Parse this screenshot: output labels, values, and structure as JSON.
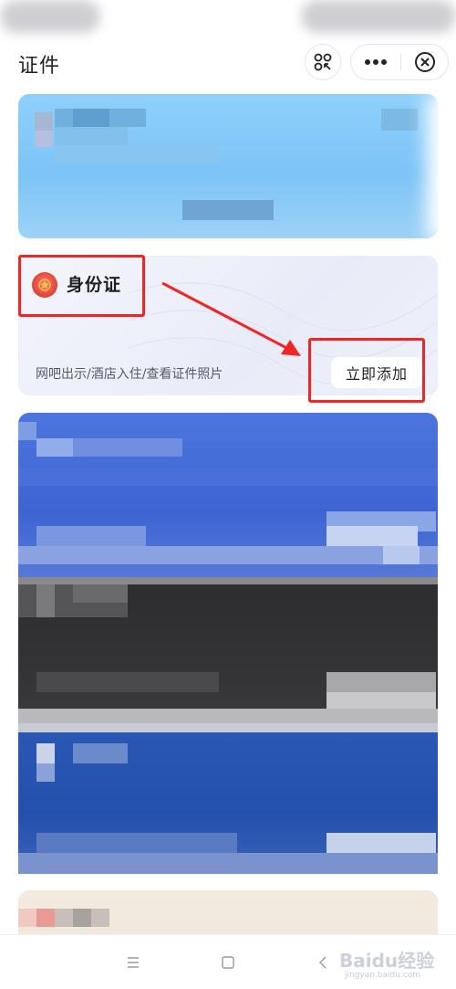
{
  "header": {
    "title": "证件",
    "scan_icon": "scan-icon",
    "more_icon": "more-dots-icon",
    "close_icon": "close-circle-icon"
  },
  "id_card": {
    "title": "身份证",
    "description": "网吧出示/酒店入住/查看证件照片",
    "add_button_label": "立即添加",
    "emblem_icon": "national-emblem-icon"
  },
  "colors": {
    "accent_red": "#f02525",
    "card_light_blue": "#8fd0fb",
    "card_blue": "#4d76dd",
    "card_dark": "#2d2d2f",
    "card_royal_blue": "#2b58b5",
    "card_beige": "#f3ebe0"
  },
  "navbar": {
    "menu_icon": "menu-icon",
    "home_icon": "home-square-icon",
    "back_icon": "back-chevron-icon"
  },
  "watermark": {
    "text": "Baidu经验",
    "sub": "jingyan.baidu.com"
  }
}
